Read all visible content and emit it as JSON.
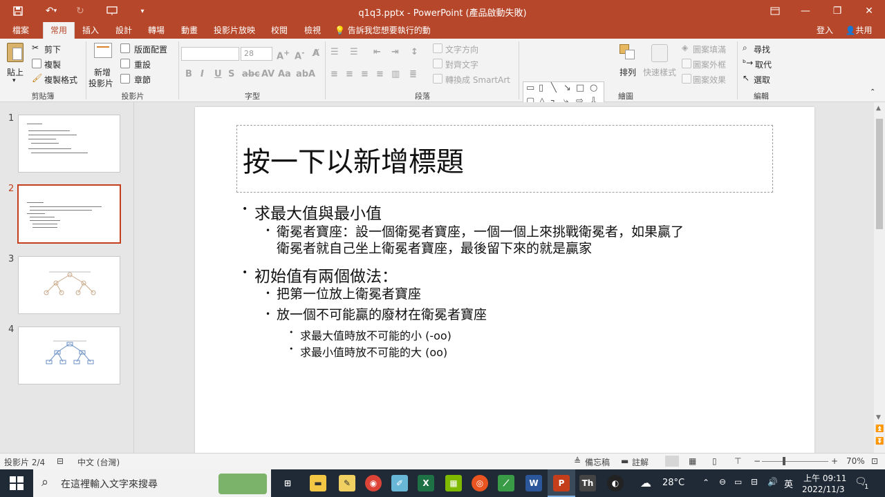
{
  "window": {
    "title": "q1q3.pptx - PowerPoint (產品啟動失敗)",
    "save_icon": "save-icon",
    "undo_icon": "undo-icon",
    "redo_icon": "redo-icon",
    "present_icon": "present-icon",
    "signin": "登入",
    "share": "共用"
  },
  "tabs": [
    "檔案",
    "常用",
    "插入",
    "設計",
    "轉場",
    "動畫",
    "投影片放映",
    "校閱",
    "檢視"
  ],
  "tellme": "告訴我您想要執行的動作...",
  "ribbon": {
    "clipboard": {
      "paste": "貼上",
      "cut": "剪下",
      "copy": "複製",
      "format_painter": "複製格式",
      "label": "剪貼簿"
    },
    "slides": {
      "new_slide_1": "新增",
      "new_slide_2": "投影片",
      "layout": "版面配置",
      "reset": "重設",
      "section": "章節",
      "label": "投影片"
    },
    "font": {
      "name_value": "",
      "size_value": "28",
      "label": "字型"
    },
    "paragraph": {
      "text_direction": "文字方向",
      "align_text": "對齊文字",
      "smartart": "轉換成 SmartArt",
      "label": "段落"
    },
    "drawing": {
      "arrange": "排列",
      "quick_styles": "快速樣式",
      "shape_fill": "圖案填滿",
      "shape_outline": "圖案外框",
      "shape_effects": "圖案效果",
      "label": "繪圖"
    },
    "editing": {
      "find": "尋找",
      "replace": "取代",
      "select": "選取",
      "label": "編輯"
    }
  },
  "thumbnails": [
    "1",
    "2",
    "3",
    "4"
  ],
  "slide": {
    "title_placeholder": "按一下以新增標題",
    "bullets": {
      "b1": "求最大值與最小值",
      "b1a_line1": "衛冕者寶座：設一個衛冕者寶座，一個一個上來挑戰衛冕者，如果贏了",
      "b1a_line2": "衛冕者就自己坐上衛冕者寶座，最後留下來的就是贏家",
      "b2": "初始值有兩個做法：",
      "b2a": "把第一位放上衛冕者寶座",
      "b2b": "放一個不可能贏的廢材在衛冕者寶座",
      "b2b1": "求最大值時放不可能的小 (-oo)",
      "b2b2": "求最小值時放不可能的大 (oo)"
    }
  },
  "status": {
    "slide_count": "投影片 2/4",
    "language": "中文 (台灣)",
    "notes": "備忘稿",
    "comments": "註解",
    "zoom": "70%"
  },
  "taskbar": {
    "search_placeholder": "在這裡輸入文字來搜尋",
    "weather": "28°C",
    "ime": "英",
    "time": "上午 09:11",
    "date": "2022/11/3",
    "notif_count": "1"
  }
}
